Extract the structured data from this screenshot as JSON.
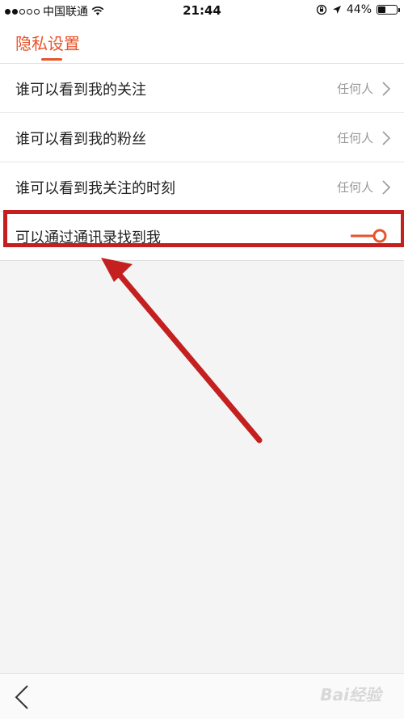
{
  "status_bar": {
    "carrier": "中国联通",
    "time": "21:44",
    "battery": "44%",
    "battery_level": 0.44,
    "signal_dots_filled": 2,
    "signal_dots_total": 5
  },
  "header": {
    "title": "隐私设置"
  },
  "settings": [
    {
      "label": "谁可以看到我的关注",
      "value": "任何人"
    },
    {
      "label": "谁可以看到我的粉丝",
      "value": "任何人"
    },
    {
      "label": "谁可以看到我关注的时刻",
      "value": "任何人"
    }
  ],
  "toggle_row": {
    "label": "可以通过通讯录找到我",
    "enabled": false
  },
  "colors": {
    "accent": "#e8532a",
    "annotation": "#c4201f"
  },
  "watermark": "Bai经验"
}
